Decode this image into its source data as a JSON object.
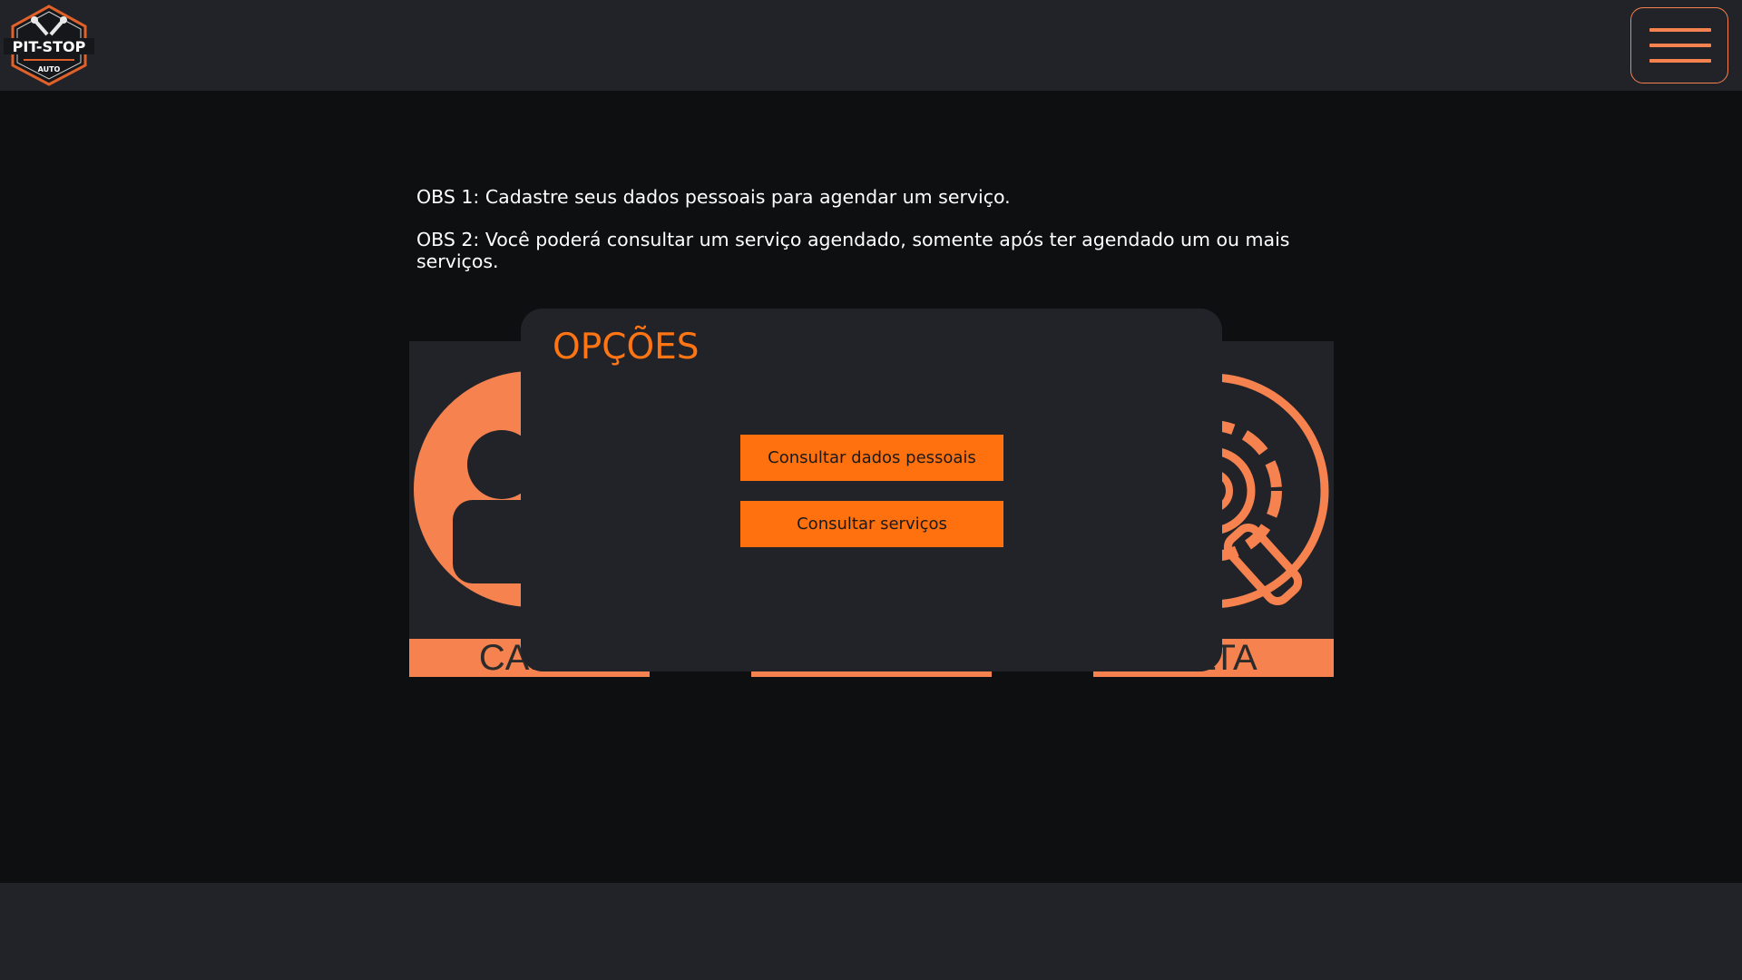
{
  "header": {
    "logo_text": "PIT-STOP",
    "logo_subtext": "AUTO",
    "menu_icon": "hamburger-icon"
  },
  "notes": {
    "obs1": "OBS 1: Cadastre seus dados pessoais para agendar um serviço.",
    "obs2": "OBS 2: Você poderá consultar um serviço agendado, somente após ter agendado um ou mais serviços."
  },
  "cards": {
    "left_label": "CADA",
    "right_label": "ULTA",
    "left_icon": "user-icon",
    "right_icon": "gear-search-icon"
  },
  "modal": {
    "title": "OPÇÕES",
    "buttons": [
      "Consultar dados pessoais",
      "Consultar serviços"
    ]
  },
  "colors": {
    "accent": "#ff7413",
    "card_accent": "#f5824f",
    "surface": "#212328",
    "background": "#0e0f10"
  }
}
